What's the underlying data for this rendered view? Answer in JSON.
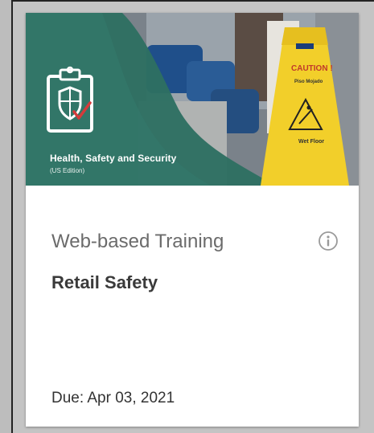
{
  "card": {
    "banner": {
      "title": "Health, Safety and Security",
      "subtitle": "(US Edition)",
      "sign_caution": "CAUTION !",
      "sign_line2": "Piso Mojado",
      "sign_line3": "Wet Floor",
      "accent_color": "#2e6f62",
      "sign_color": "#f2cf2a"
    },
    "type_label": "Web-based Training",
    "title": "Retail Safety",
    "due": "Due: Apr 03, 2021",
    "info_icon": "info-icon"
  }
}
